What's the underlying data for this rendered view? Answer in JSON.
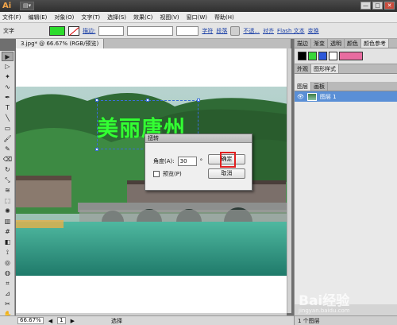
{
  "titlebar": {
    "app_logo": "Ai",
    "view_btn": "▤▾",
    "min": "—",
    "max": "□",
    "close": "✕"
  },
  "menu": [
    "文件(F)",
    "编辑(E)",
    "对象(O)",
    "文字(T)",
    "选择(S)",
    "效果(C)",
    "视图(V)",
    "窗口(W)",
    "帮助(H)"
  ],
  "controlbar": {
    "label": "文字",
    "stroke_link": "描边:",
    "char_link": "字符",
    "para_link": "段落",
    "opacity_link": "不透...",
    "align_link": "对齐",
    "flash_link": "Flash 文本",
    "transform_link": "变换",
    "fill_color": "#2ddc2d"
  },
  "document": {
    "tab": "3.jpg* @ 66.67% (RGB/预览)"
  },
  "artwork": {
    "text": "美丽唐州"
  },
  "dialog": {
    "title": "扭转",
    "angle_label": "角度(A):",
    "angle_value": "30",
    "unit": "°",
    "preview_label": "预览(P)",
    "ok": "确定",
    "cancel": "取消"
  },
  "status": {
    "zoom": "66.67%",
    "page": "1",
    "tool": "选择"
  },
  "panels": {
    "top_tabs": [
      "描边",
      "渐变",
      "透明",
      "颜色",
      "颜色参考"
    ],
    "mid_tabs": [
      "外观",
      "图形样式"
    ],
    "layer_tabs": [
      "图层",
      "画板"
    ],
    "layer_name": "图层 1",
    "footer": "1 个图层",
    "swatches": [
      "#000000",
      "#39d639",
      "#2b57d9",
      "#ffffff",
      "#e86ca0"
    ]
  },
  "watermark": {
    "brand": "Bai",
    "suffix": "经验",
    "url": "jingyan.baidu.com"
  }
}
